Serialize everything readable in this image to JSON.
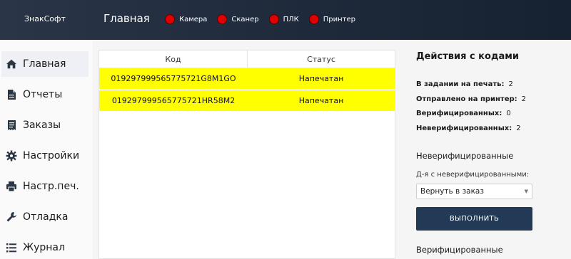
{
  "header": {
    "brand": "ЗнакСофт",
    "page_title": "Главная",
    "indicators": [
      {
        "label": "Камера",
        "color": "#e00000"
      },
      {
        "label": "Сканер",
        "color": "#e00000"
      },
      {
        "label": "ПЛК",
        "color": "#e00000"
      },
      {
        "label": "Принтер",
        "color": "#e00000"
      }
    ]
  },
  "sidebar": {
    "items": [
      {
        "label": "Главная",
        "icon": "home-icon",
        "active": true
      },
      {
        "label": "Отчеты",
        "icon": "document-icon",
        "active": false
      },
      {
        "label": "Заказы",
        "icon": "receipt-icon",
        "active": false
      },
      {
        "label": "Настройки",
        "icon": "gear-icon",
        "active": false
      },
      {
        "label": "Настр.печ.",
        "icon": "printer-icon",
        "active": false
      },
      {
        "label": "Отладка",
        "icon": "wrench-icon",
        "active": false
      },
      {
        "label": "Журнал",
        "icon": "list-icon",
        "active": false
      }
    ]
  },
  "table": {
    "columns": [
      "Код",
      "Статус"
    ],
    "rows": [
      {
        "code": "0192979995657757​21G8M1GO",
        "status": "Напечатан",
        "highlight": "#ffff00"
      },
      {
        "code": "019297999565775721HR58M2",
        "status": "Напечатан",
        "highlight": "#ffff00"
      }
    ]
  },
  "actions": {
    "title": "Действия с кодами",
    "stats": [
      {
        "label": "В задании на печать:",
        "value": "2"
      },
      {
        "label": "Отправлено на принтер:",
        "value": "2"
      },
      {
        "label": "Верифицированных:",
        "value": "0"
      },
      {
        "label": "Неверифицированных:",
        "value": "2"
      }
    ],
    "unverified_section_title": "Неверифицированные",
    "unverified_field_label": "Д-я с неверифицированными:",
    "unverified_selected": "Вернуть в заказ",
    "execute_label": "ВЫПОЛНИТЬ",
    "verified_section_title": "Верифицированные"
  },
  "colors": {
    "header_bg": "#1f2b3c",
    "row_highlight": "#ffff00",
    "button_bg": "#223a55",
    "indicator_off": "#e00000"
  }
}
